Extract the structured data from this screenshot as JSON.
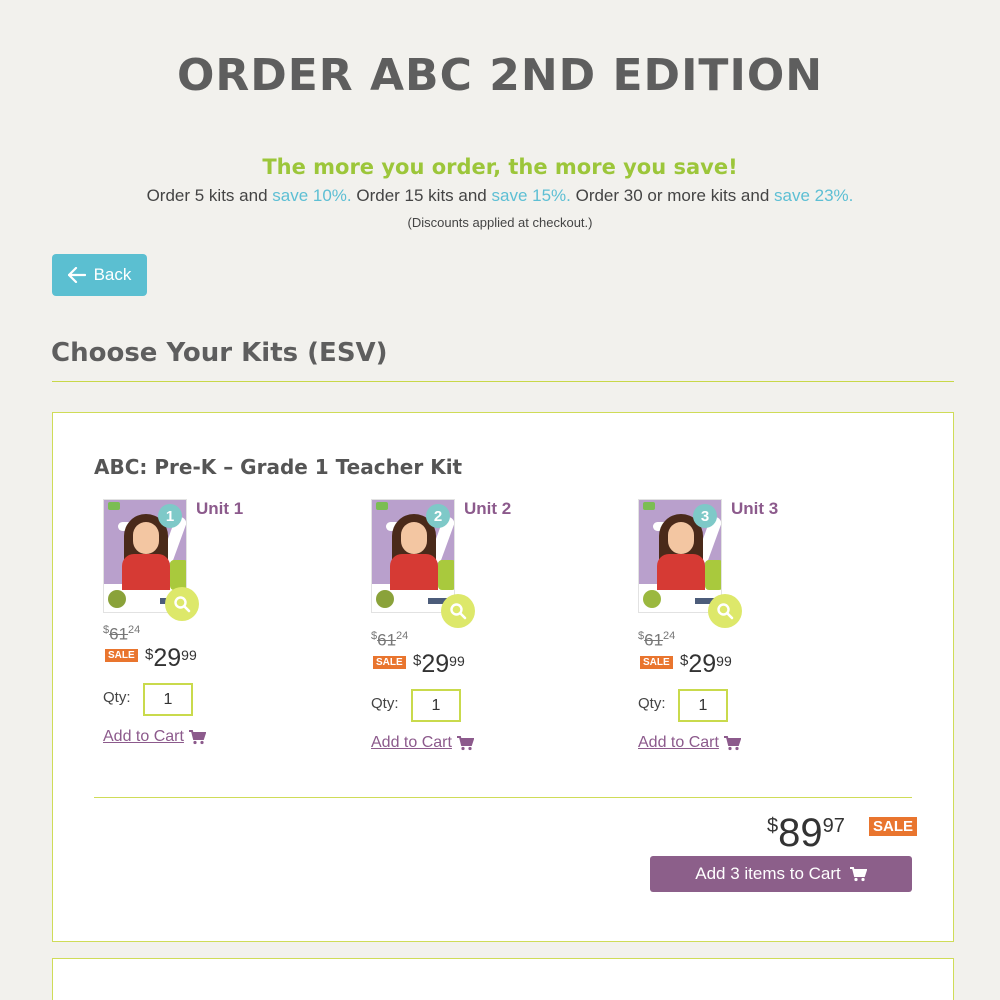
{
  "header": {
    "title": "ORDER ABC 2ND EDITION"
  },
  "promo": {
    "headline": "The more you order, the more you save!",
    "line": {
      "t1": "Order 5 kits and ",
      "h1": "save 10%.",
      "t2": " Order 15 kits and ",
      "h2": "save 15%.",
      "t3": " Order 30 or more kits and ",
      "h3": "save 23%."
    },
    "note": "(Discounts applied at checkout.)"
  },
  "back": {
    "label": "Back"
  },
  "section": {
    "title": "Choose Your Kits (ESV)"
  },
  "kit": {
    "title": "ABC: Pre-K – Grade 1 Teacher Kit",
    "units": [
      {
        "name": "Unit 1",
        "badge": "1",
        "old_dollars": "61",
        "old_cents": "24",
        "sale": "SALE",
        "currency": "$",
        "dollars": "29",
        "cents": "99",
        "qty_label": "Qty:",
        "qty": "1",
        "add_label": "Add to Cart"
      },
      {
        "name": "Unit 2",
        "badge": "2",
        "old_dollars": "61",
        "old_cents": "24",
        "sale": "SALE",
        "currency": "$",
        "dollars": "29",
        "cents": "99",
        "qty_label": "Qty:",
        "qty": "1",
        "add_label": "Add to Cart"
      },
      {
        "name": "Unit 3",
        "badge": "3",
        "old_dollars": "61",
        "old_cents": "24",
        "sale": "SALE",
        "currency": "$",
        "dollars": "29",
        "cents": "99",
        "qty_label": "Qty:",
        "qty": "1",
        "add_label": "Add to Cart"
      }
    ],
    "total": {
      "currency": "$",
      "dollars": "89",
      "cents": "97",
      "sale": "SALE"
    },
    "add_all_label": "Add 3 items to Cart"
  },
  "colors": {
    "accent_green": "#9cc63a",
    "accent_blue": "#5dbfd4",
    "accent_purple": "#8c5a8c",
    "sale_orange": "#e9752e"
  },
  "icons": {
    "back": "arrow-left-icon",
    "cart": "cart-icon",
    "zoom": "magnifier-icon"
  }
}
